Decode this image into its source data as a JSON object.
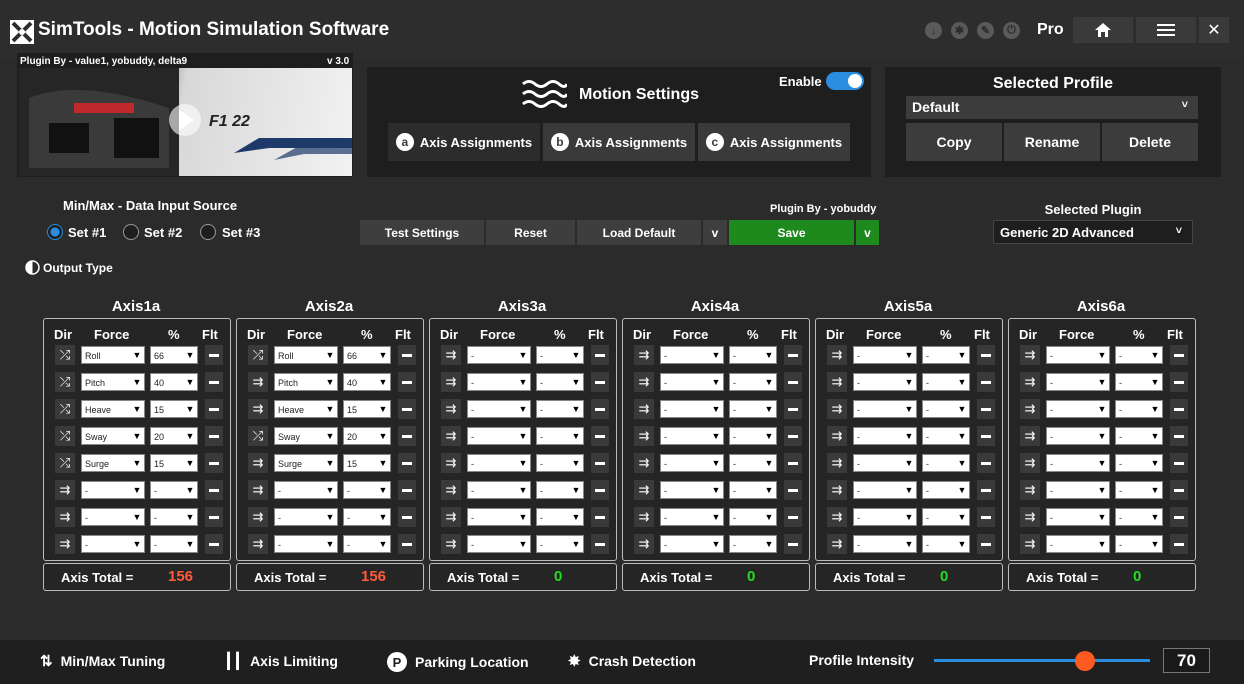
{
  "window": {
    "title": "SimTools - Motion Simulation Software",
    "tier": "Pro"
  },
  "plugin_preview": {
    "credit": "Plugin By - value1, yobuddy, delta9",
    "version": "v 3.0",
    "game_logo": "F1 22"
  },
  "motion": {
    "title": "Motion Settings",
    "enable_label": "Enable",
    "enabled": true,
    "tabs": [
      {
        "badge": "a",
        "label": "Axis Assignments"
      },
      {
        "badge": "b",
        "label": "Axis Assignments"
      },
      {
        "badge": "c",
        "label": "Axis Assignments"
      }
    ]
  },
  "profile": {
    "title": "Selected Profile",
    "selected": "Default",
    "copy": "Copy",
    "rename": "Rename",
    "delete": "Delete"
  },
  "minmax": {
    "title": "Min/Max - Data Input Source",
    "sets": [
      "Set #1",
      "Set #2",
      "Set #3"
    ],
    "selected": 0
  },
  "output_type": "Output Type",
  "toolbar": {
    "test": "Test Settings",
    "reset": "Reset",
    "load_default": "Load Default",
    "save": "Save",
    "plugin_credit": "Plugin By - yobuddy",
    "chevron": "v"
  },
  "plugin_select": {
    "title": "Selected Plugin",
    "value": "Generic 2D Advanced"
  },
  "axis_headers": {
    "dir": "Dir",
    "force": "Force",
    "pct": "%",
    "flt": "Flt"
  },
  "axis_total_label": "Axis Total =",
  "axes": [
    {
      "name": "Axis1a",
      "total": "156",
      "total_color": "#ff5a3c",
      "rows": [
        {
          "dir": "shuffle",
          "force": "Roll",
          "pct": "66"
        },
        {
          "dir": "shuffle",
          "force": "Pitch",
          "pct": "40"
        },
        {
          "dir": "shuffle",
          "force": "Heave",
          "pct": "15"
        },
        {
          "dir": "shuffle",
          "force": "Sway",
          "pct": "20"
        },
        {
          "dir": "shuffle",
          "force": "Surge",
          "pct": "15"
        },
        {
          "dir": "arrow",
          "force": "-",
          "pct": "-"
        },
        {
          "dir": "arrow",
          "force": "-",
          "pct": "-"
        },
        {
          "dir": "arrow",
          "force": "-",
          "pct": "-"
        }
      ]
    },
    {
      "name": "Axis2a",
      "total": "156",
      "total_color": "#ff5a3c",
      "rows": [
        {
          "dir": "shuffle",
          "force": "Roll",
          "pct": "66"
        },
        {
          "dir": "arrow",
          "force": "Pitch",
          "pct": "40"
        },
        {
          "dir": "arrow",
          "force": "Heave",
          "pct": "15"
        },
        {
          "dir": "shuffle",
          "force": "Sway",
          "pct": "20"
        },
        {
          "dir": "arrow",
          "force": "Surge",
          "pct": "15"
        },
        {
          "dir": "arrow",
          "force": "-",
          "pct": "-"
        },
        {
          "dir": "arrow",
          "force": "-",
          "pct": "-"
        },
        {
          "dir": "arrow",
          "force": "-",
          "pct": "-"
        }
      ]
    },
    {
      "name": "Axis3a",
      "total": "0",
      "total_color": "#22dd22",
      "rows": [
        {
          "dir": "arrow",
          "force": "-",
          "pct": "-"
        },
        {
          "dir": "arrow",
          "force": "-",
          "pct": "-"
        },
        {
          "dir": "arrow",
          "force": "-",
          "pct": "-"
        },
        {
          "dir": "arrow",
          "force": "-",
          "pct": "-"
        },
        {
          "dir": "arrow",
          "force": "-",
          "pct": "-"
        },
        {
          "dir": "arrow",
          "force": "-",
          "pct": "-"
        },
        {
          "dir": "arrow",
          "force": "-",
          "pct": "-"
        },
        {
          "dir": "arrow",
          "force": "-",
          "pct": "-"
        }
      ]
    },
    {
      "name": "Axis4a",
      "total": "0",
      "total_color": "#22dd22",
      "rows": [
        {
          "dir": "arrow",
          "force": "-",
          "pct": "-"
        },
        {
          "dir": "arrow",
          "force": "-",
          "pct": "-"
        },
        {
          "dir": "arrow",
          "force": "-",
          "pct": "-"
        },
        {
          "dir": "arrow",
          "force": "-",
          "pct": "-"
        },
        {
          "dir": "arrow",
          "force": "-",
          "pct": "-"
        },
        {
          "dir": "arrow",
          "force": "-",
          "pct": "-"
        },
        {
          "dir": "arrow",
          "force": "-",
          "pct": "-"
        },
        {
          "dir": "arrow",
          "force": "-",
          "pct": "-"
        }
      ]
    },
    {
      "name": "Axis5a",
      "total": "0",
      "total_color": "#22dd22",
      "rows": [
        {
          "dir": "arrow",
          "force": "-",
          "pct": "-"
        },
        {
          "dir": "arrow",
          "force": "-",
          "pct": "-"
        },
        {
          "dir": "arrow",
          "force": "-",
          "pct": "-"
        },
        {
          "dir": "arrow",
          "force": "-",
          "pct": "-"
        },
        {
          "dir": "arrow",
          "force": "-",
          "pct": "-"
        },
        {
          "dir": "arrow",
          "force": "-",
          "pct": "-"
        },
        {
          "dir": "arrow",
          "force": "-",
          "pct": "-"
        },
        {
          "dir": "arrow",
          "force": "-",
          "pct": "-"
        }
      ]
    },
    {
      "name": "Axis6a",
      "total": "0",
      "total_color": "#22dd22",
      "rows": [
        {
          "dir": "arrow",
          "force": "-",
          "pct": "-"
        },
        {
          "dir": "arrow",
          "force": "-",
          "pct": "-"
        },
        {
          "dir": "arrow",
          "force": "-",
          "pct": "-"
        },
        {
          "dir": "arrow",
          "force": "-",
          "pct": "-"
        },
        {
          "dir": "arrow",
          "force": "-",
          "pct": "-"
        },
        {
          "dir": "arrow",
          "force": "-",
          "pct": "-"
        },
        {
          "dir": "arrow",
          "force": "-",
          "pct": "-"
        },
        {
          "dir": "arrow",
          "force": "-",
          "pct": "-"
        }
      ]
    }
  ],
  "footer": {
    "minmax_tuning": "Min/Max Tuning",
    "axis_limiting": "Axis Limiting",
    "parking_location": "Parking Location",
    "crash_detection": "Crash Detection",
    "intensity_label": "Profile Intensity",
    "intensity": "70",
    "intensity_fraction": 0.7
  },
  "colors": {
    "accent": "#2a8de0",
    "save": "#1e8a1e",
    "slider_thumb": "#ff5a1f"
  }
}
